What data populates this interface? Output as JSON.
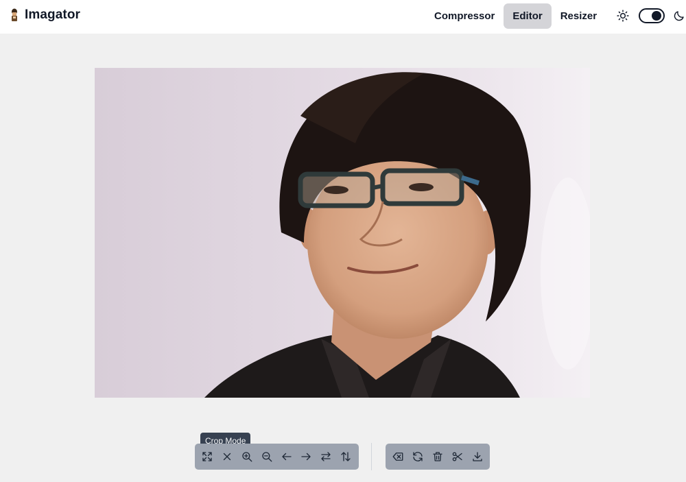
{
  "app": {
    "name": "Imagator"
  },
  "nav": {
    "tabs": [
      {
        "label": "Compressor",
        "active": false
      },
      {
        "label": "Editor",
        "active": true
      },
      {
        "label": "Resizer",
        "active": false
      }
    ]
  },
  "theme": {
    "mode": "light",
    "icons": [
      "sun-icon",
      "moon-icon"
    ]
  },
  "editor": {
    "tooltip": "Crop Mode",
    "toolbar_left": [
      "crop-mode-icon",
      "close-icon",
      "zoom-in-icon",
      "zoom-out-icon",
      "move-left-icon",
      "move-right-icon",
      "flip-horizontal-icon",
      "flip-vertical-icon"
    ],
    "toolbar_right": [
      "clear-icon",
      "reset-icon",
      "delete-icon",
      "cut-icon",
      "download-icon"
    ]
  },
  "colors": {
    "active_tab": "#d4d4d8",
    "toolbar": "#9ca3af",
    "page_bg": "#f0f0f0",
    "tooltip_bg": "#374151"
  }
}
